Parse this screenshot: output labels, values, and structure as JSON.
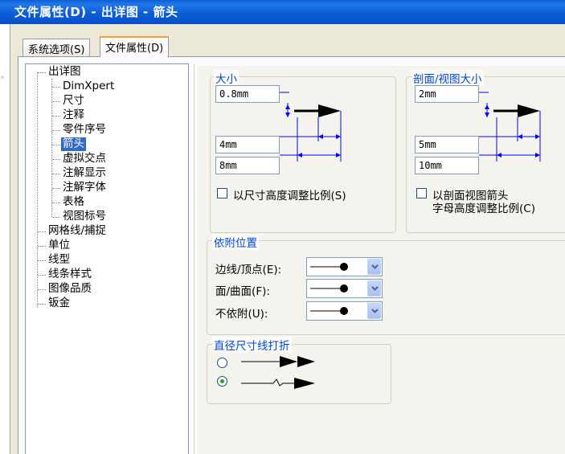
{
  "window": {
    "title": "文件属性(D) - 出详图 - 箭头"
  },
  "tabs": [
    {
      "label": "系统选项(S)"
    },
    {
      "label": "文件属性(D)"
    }
  ],
  "tree": {
    "items": [
      {
        "label": "出详图"
      },
      {
        "label": "DimXpert"
      },
      {
        "label": "尺寸"
      },
      {
        "label": "注释"
      },
      {
        "label": "零件序号"
      },
      {
        "label": "箭头"
      },
      {
        "label": "虚拟交点"
      },
      {
        "label": "注解显示"
      },
      {
        "label": "注解字体"
      },
      {
        "label": "表格"
      },
      {
        "label": "视图标号"
      },
      {
        "label": "网格线/捕捉"
      },
      {
        "label": "单位"
      },
      {
        "label": "线型"
      },
      {
        "label": "线条样式"
      },
      {
        "label": "图像品质"
      },
      {
        "label": "钣金"
      }
    ],
    "selected": "箭头"
  },
  "size_group": {
    "title": "大小",
    "field1": "0.8mm",
    "field2": "4mm",
    "field3": "8mm",
    "checkbox_label": "以尺寸高度调整比例(S)",
    "checked": false
  },
  "section_group": {
    "title": "剖面/视图大小",
    "field1": "2mm",
    "field2": "5mm",
    "field3": "10mm",
    "checkbox_line1": "以剖面视图箭头",
    "checkbox_line2": "字母高度调整比例(C)",
    "checked": false
  },
  "attach_group": {
    "title": "依附位置",
    "edge_label": "边线/顶点(E):",
    "face_label": "面/曲面(F):",
    "none_label": "不依附(U):"
  },
  "diameter_group": {
    "title": "直径尺寸线打折",
    "selected_option": 2
  },
  "colors": {
    "accent": "#0046d5",
    "selection": "#316ac5",
    "titlebar": "#0a5fd8"
  }
}
